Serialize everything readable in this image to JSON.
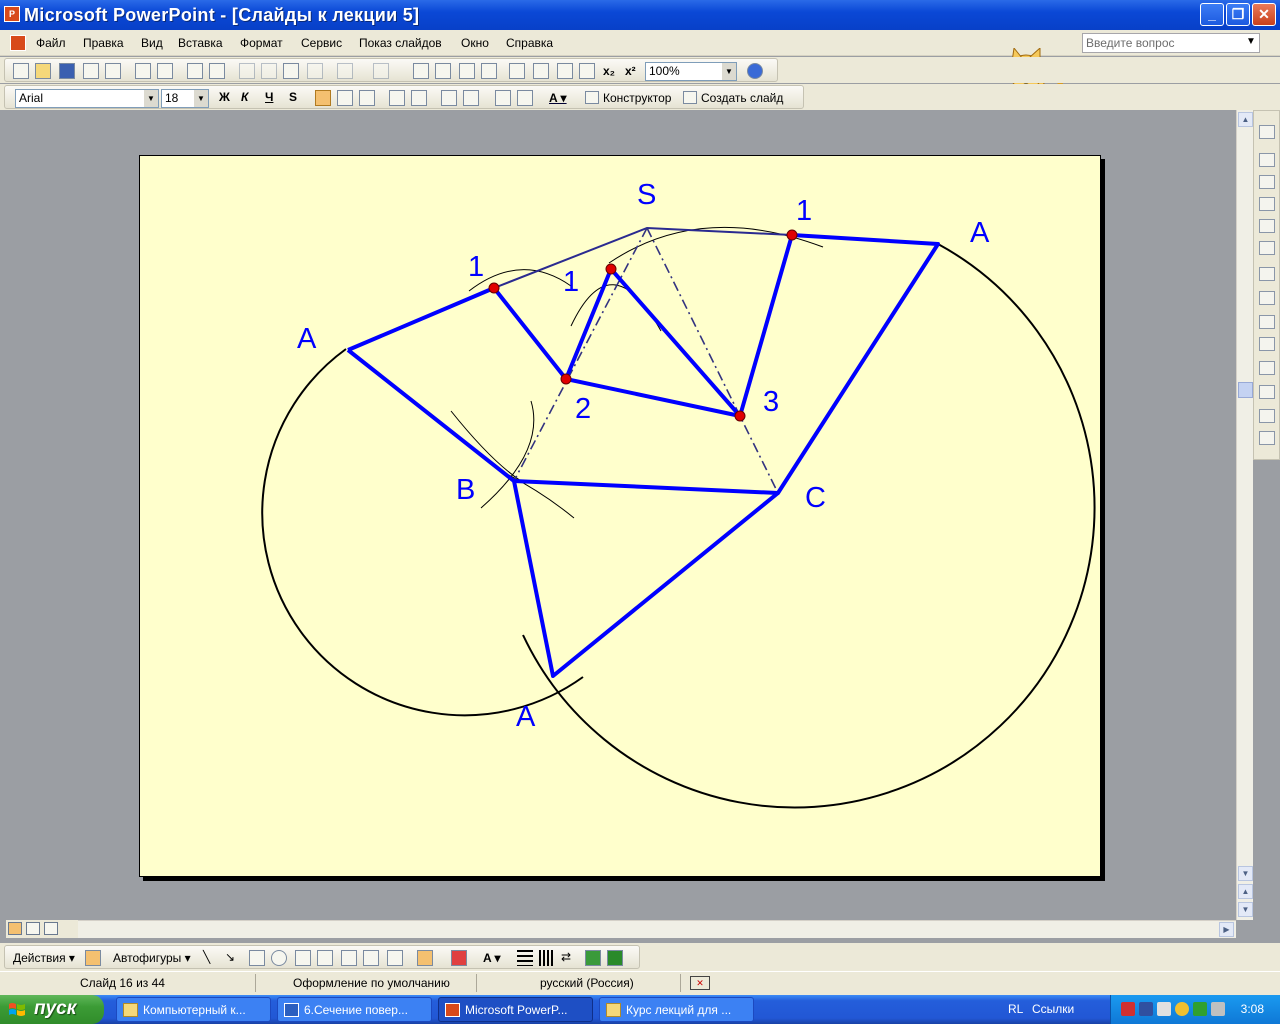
{
  "window": {
    "title": "Microsoft PowerPoint - [Слайды к лекции 5]",
    "minimize": "_",
    "restore": "❐",
    "close": "✕"
  },
  "menu": {
    "items": [
      "Файл",
      "Правка",
      "Вид",
      "Вставка",
      "Формат",
      "Сервис",
      "Показ слайдов",
      "Окно",
      "Справка"
    ],
    "help_placeholder": "Введите вопрос"
  },
  "standard_toolbar": {
    "zoom": "100%"
  },
  "format_toolbar": {
    "font": "Arial",
    "size": "18",
    "bold": "Ж",
    "italic": "К",
    "underline": "Ч",
    "shadow": "S",
    "designer": "Конструктор",
    "new_slide": "Создать слайд"
  },
  "slide": {
    "labels": {
      "S": "S",
      "A_left": "A",
      "A_right": "A",
      "A_bottom": "A",
      "B": "B",
      "C": "C",
      "one_left": "1",
      "one_mid": "1",
      "one_right": "1",
      "two": "2",
      "three": "3"
    },
    "colors": {
      "background": "#ffffcc",
      "edge": "#0000ff",
      "point": "#e00000",
      "arc": "#000000",
      "dashed": "#333380"
    }
  },
  "drawing_toolbar": {
    "actions": "Действия",
    "autoshapes": "Автофигуры"
  },
  "status": {
    "slide": "Слайд 16 из 44",
    "design": "Оформление по умолчанию",
    "language": "русский (Россия)"
  },
  "taskbar": {
    "start": "пуск",
    "tasks": [
      "Компьютерный к...",
      "6.Сечение повер...",
      "Microsoft PowerP...",
      "Курс лекций для ..."
    ],
    "lang": "RL",
    "links": "Ссылки",
    "clock": "3:08"
  }
}
